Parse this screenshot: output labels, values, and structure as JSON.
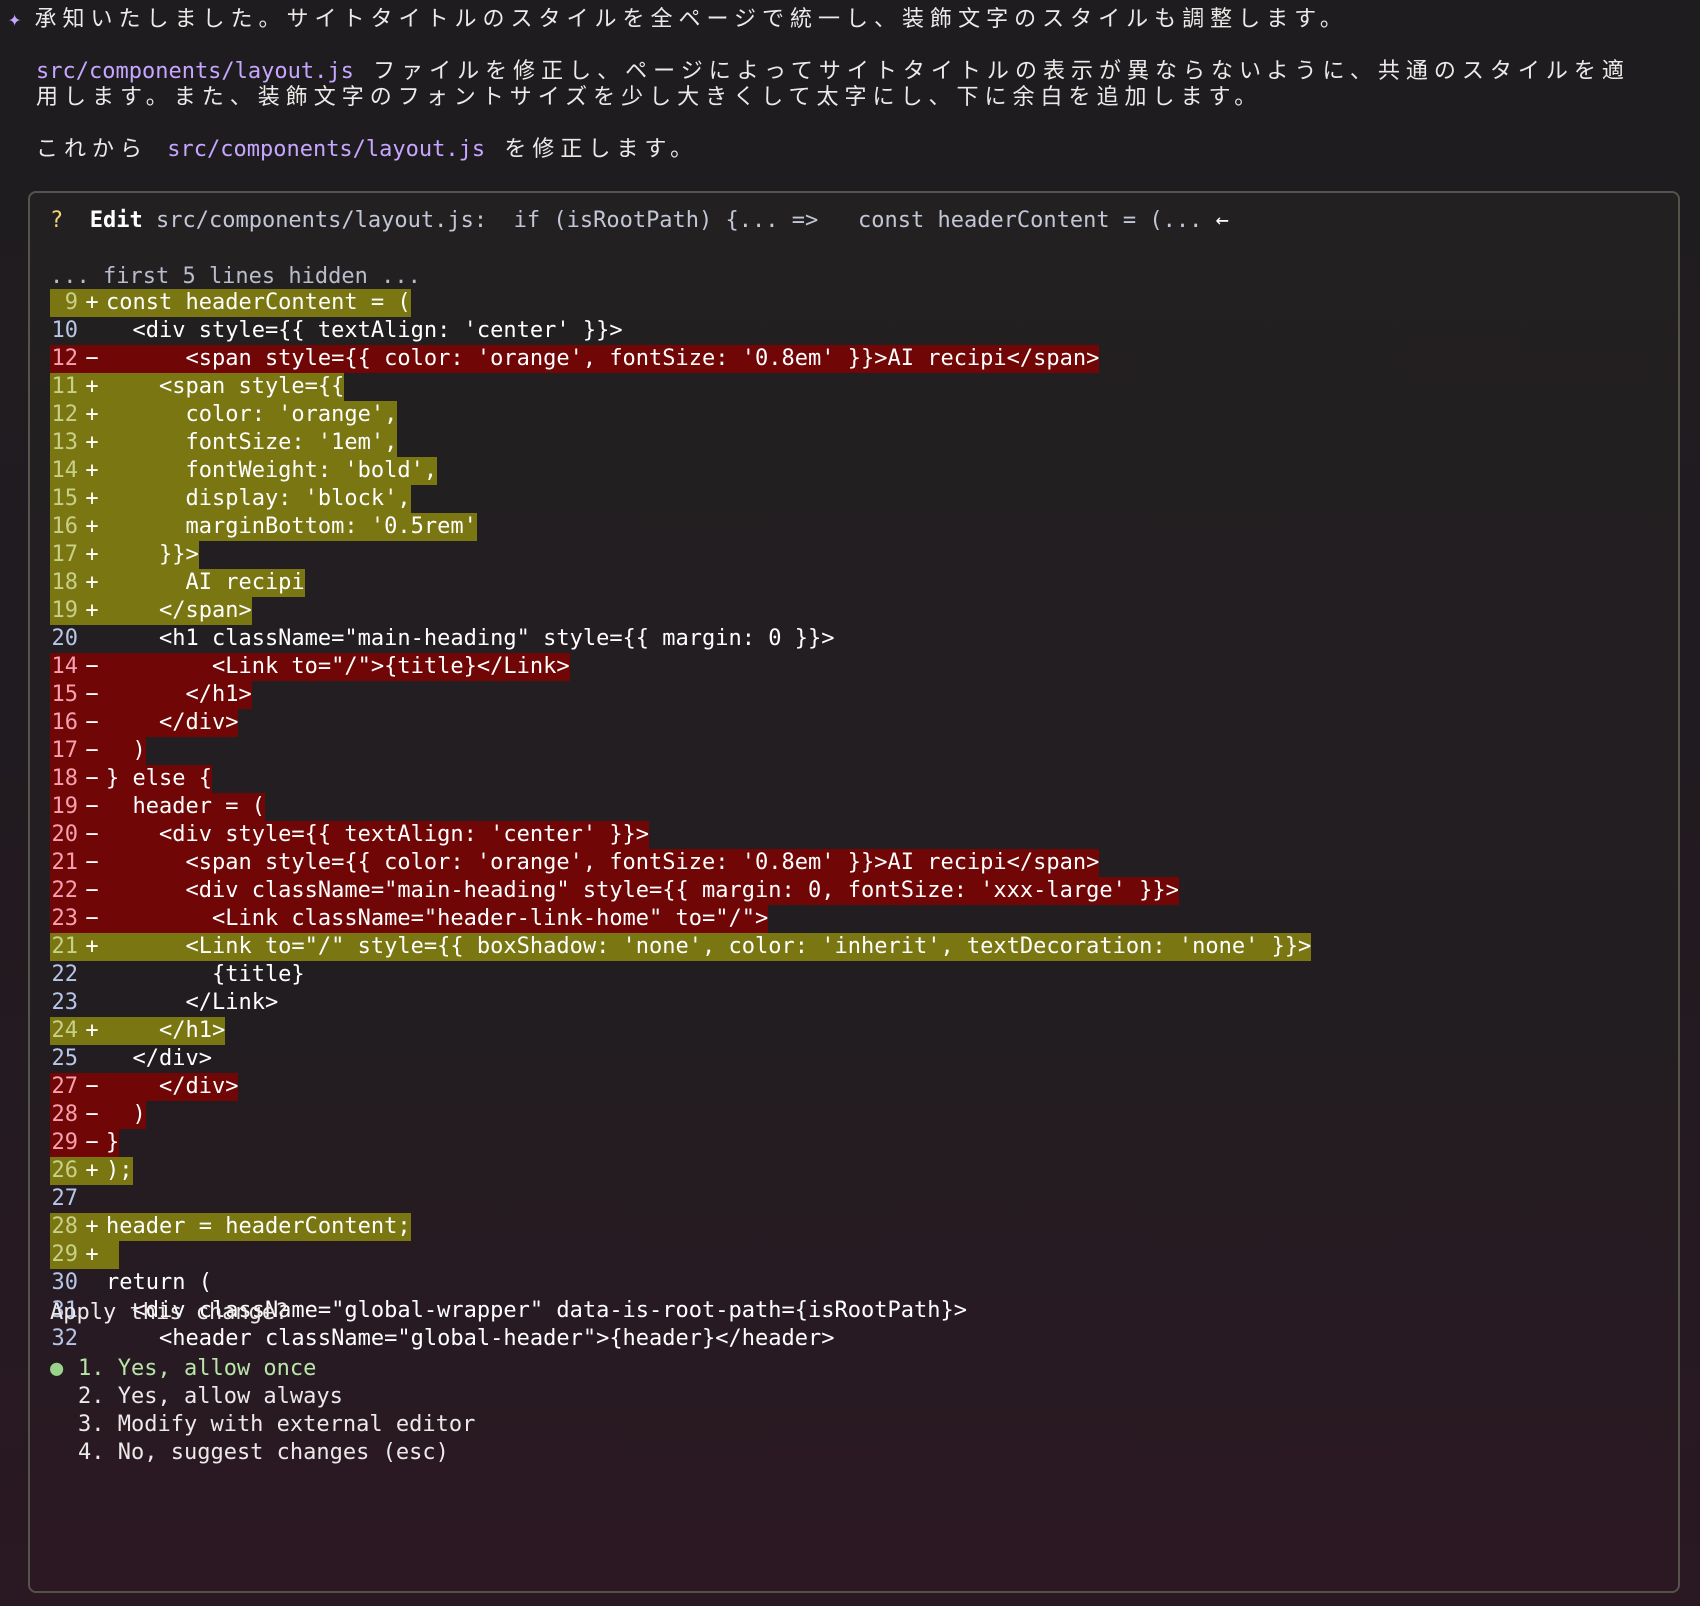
{
  "intro": {
    "star_icon": "sparkle-icon",
    "line1": "承知いたしました。サイトタイトルのスタイルを全ページで統一し、装飾文字のスタイルも調整します。",
    "line2_path": "src/components/layout.js",
    "line2_text": " ファイルを修正し、ページによってサイトタイトルの表示が異ならないように、共通のスタイルを適",
    "line3": "用します。また、装飾文字のフォントサイズを少し大きくして太字にし、下に余白を追加します。",
    "line4_prefix": "これから ",
    "line4_path": "src/components/layout.js",
    "line4_suffix": " を修正します。"
  },
  "prompt": {
    "qmark": "?",
    "edit_label": "Edit",
    "file": "src/components/layout.js:",
    "summary": "  if (isRootPath) {... =>   const headerContent = (... ",
    "arrow_icon": "left-arrow-icon",
    "arrow": "←",
    "hidden_note": "... first 5 lines hidden ...",
    "question": "Apply this change?",
    "options": [
      {
        "label": "1. Yes, allow once",
        "selected": true
      },
      {
        "label": "2. Yes, allow always",
        "selected": false
      },
      {
        "label": "3. Modify with external editor",
        "selected": false
      },
      {
        "label": "4. No, suggest changes (esc)",
        "selected": false
      }
    ]
  },
  "diff": [
    {
      "n": "9",
      "t": "add",
      "s": "+",
      "c": "const headerContent = ("
    },
    {
      "n": "10",
      "t": "ctx",
      "s": " ",
      "c": "  <div style={{ textAlign: 'center' }}>"
    },
    {
      "n": "12",
      "t": "del",
      "s": "-",
      "c": "      <span style={{ color: 'orange', fontSize: '0.8em' }}>AI recipi</span>"
    },
    {
      "n": "11",
      "t": "add",
      "s": "+",
      "c": "    <span style={{"
    },
    {
      "n": "12",
      "t": "add",
      "s": "+",
      "c": "      color: 'orange',"
    },
    {
      "n": "13",
      "t": "add",
      "s": "+",
      "c": "      fontSize: '1em',"
    },
    {
      "n": "14",
      "t": "add",
      "s": "+",
      "c": "      fontWeight: 'bold',"
    },
    {
      "n": "15",
      "t": "add",
      "s": "+",
      "c": "      display: 'block',"
    },
    {
      "n": "16",
      "t": "add",
      "s": "+",
      "c": "      marginBottom: '0.5rem'"
    },
    {
      "n": "17",
      "t": "add",
      "s": "+",
      "c": "    }}>"
    },
    {
      "n": "18",
      "t": "add",
      "s": "+",
      "c": "      AI recipi"
    },
    {
      "n": "19",
      "t": "add",
      "s": "+",
      "c": "    </span>"
    },
    {
      "n": "20",
      "t": "ctx",
      "s": " ",
      "c": "    <h1 className=\"main-heading\" style={{ margin: 0 }}>"
    },
    {
      "n": "14",
      "t": "del",
      "s": "-",
      "c": "        <Link to=\"/\">{title}</Link>"
    },
    {
      "n": "15",
      "t": "del",
      "s": "-",
      "c": "      </h1>"
    },
    {
      "n": "16",
      "t": "del",
      "s": "-",
      "c": "    </div>"
    },
    {
      "n": "17",
      "t": "del",
      "s": "-",
      "c": "  )"
    },
    {
      "n": "18",
      "t": "del",
      "s": "-",
      "c": "} else {"
    },
    {
      "n": "19",
      "t": "del",
      "s": "-",
      "c": "  header = ("
    },
    {
      "n": "20",
      "t": "del",
      "s": "-",
      "c": "    <div style={{ textAlign: 'center' }}>"
    },
    {
      "n": "21",
      "t": "del",
      "s": "-",
      "c": "      <span style={{ color: 'orange', fontSize: '0.8em' }}>AI recipi</span>"
    },
    {
      "n": "22",
      "t": "del",
      "s": "-",
      "c": "      <div className=\"main-heading\" style={{ margin: 0, fontSize: 'xxx-large' }}>"
    },
    {
      "n": "23",
      "t": "del",
      "s": "-",
      "c": "        <Link className=\"header-link-home\" to=\"/\">"
    },
    {
      "n": "21",
      "t": "add",
      "s": "+",
      "c": "      <Link to=\"/\" style={{ boxShadow: 'none', color: 'inherit', textDecoration: 'none' }}>"
    },
    {
      "n": "22",
      "t": "ctx",
      "s": " ",
      "c": "        {title}"
    },
    {
      "n": "23",
      "t": "ctx",
      "s": " ",
      "c": "      </Link>"
    },
    {
      "n": "24",
      "t": "add",
      "s": "+",
      "c": "    </h1>"
    },
    {
      "n": "25",
      "t": "ctx",
      "s": " ",
      "c": "  </div>"
    },
    {
      "n": "27",
      "t": "del",
      "s": "-",
      "c": "    </div>"
    },
    {
      "n": "28",
      "t": "del",
      "s": "-",
      "c": "  )"
    },
    {
      "n": "29",
      "t": "del",
      "s": "-",
      "c": "}"
    },
    {
      "n": "26",
      "t": "add",
      "s": "+",
      "c": ");"
    },
    {
      "n": "27",
      "t": "ctx",
      "s": " ",
      "c": ""
    },
    {
      "n": "28",
      "t": "add",
      "s": "+",
      "c": "header = headerContent;"
    },
    {
      "n": "29",
      "t": "add",
      "s": "+",
      "c": ""
    },
    {
      "n": "30",
      "t": "ctx",
      "s": " ",
      "c": "return ("
    },
    {
      "n": "31",
      "t": "ctx",
      "s": " ",
      "c": "  <div className=\"global-wrapper\" data-is-root-path={isRootPath}>"
    },
    {
      "n": "32",
      "t": "ctx",
      "s": " ",
      "c": "    <header className=\"global-header\">{header}</header>"
    }
  ],
  "colors": {
    "add_bg": "#7a7612",
    "del_bg": "#710606",
    "accent": "#c6a6ff",
    "border": "#56534c"
  }
}
